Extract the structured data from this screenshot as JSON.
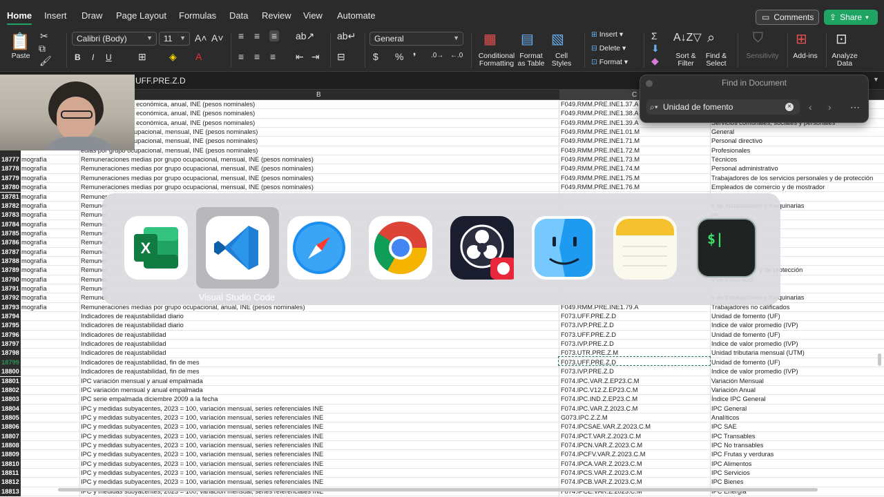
{
  "tabs": [
    "Home",
    "Insert",
    "Draw",
    "Page Layout",
    "Formulas",
    "Data",
    "Review",
    "View",
    "Automate"
  ],
  "header": {
    "comments": "Comments",
    "share": "Share"
  },
  "ribbon": {
    "paste": "Paste",
    "font_name": "Calibri (Body)",
    "font_size": "11",
    "number_format": "General",
    "conditional_formatting": [
      "Conditional",
      "Formatting"
    ],
    "format_as_table": [
      "Format",
      "as Table"
    ],
    "cell_styles": [
      "Cell",
      "Styles"
    ],
    "insert": "Insert",
    "delete": "Delete",
    "format": "Format",
    "sort_filter": [
      "Sort &",
      "Filter"
    ],
    "find_select": [
      "Find &",
      "Select"
    ],
    "sensitivity": "Sensitivity",
    "addins": "Add-ins",
    "analyze_data": [
      "Analyze",
      "Data"
    ]
  },
  "formula_bar": {
    "content": "UFF.PRE.Z.D"
  },
  "columns": {
    "b": "B",
    "c": "C"
  },
  "find_panel": {
    "title": "Find in Document",
    "query": "Unidad de fomento"
  },
  "switcher": {
    "selected_label": "Visual Studio Code",
    "apps": [
      "excel-icon",
      "vscode-icon",
      "safari-icon",
      "chrome-icon",
      "obs-icon",
      "finder-icon",
      "notes-icon",
      "terminal-icon"
    ],
    "terminal_glyph": "$|"
  },
  "colors": {
    "excel_green": "#1fa463",
    "selection_dash": "#1e7a45"
  },
  "rows": [
    {
      "n": "",
      "a": "",
      "b": "edias por actividad económica, anual, INE (pesos nominales)",
      "c": "F049.RMM.PRE.INE1.37.A",
      "d": ""
    },
    {
      "n": "",
      "a": "",
      "b": "edias por actividad económica, anual, INE (pesos nominales)",
      "c": "F049.RMM.PRE.INE1.38.A",
      "d": "Servicios comunales, sociales y personales pres"
    },
    {
      "n": "",
      "a": "",
      "b": "edias por actividad económica, anual, INE (pesos nominales)",
      "c": "F049.RMM.PRE.INE1.39.A",
      "d": "Servicios comunales, sociales y personales"
    },
    {
      "n": "",
      "a": "",
      "b": "edias por grupo ocupacional, mensual, INE (pesos nominales)",
      "c": "F049.RMM.PRE.INE1.01.M",
      "d": "General"
    },
    {
      "n": "",
      "a": "",
      "b": "edias por grupo ocupacional, mensual, INE (pesos nominales)",
      "c": "F049.RMM.PRE.INE1.71.M",
      "d": "Personal directivo"
    },
    {
      "n": "",
      "a": "",
      "b": "edias por grupo ocupacional, mensual, INE (pesos nominales)",
      "c": "F049.RMM.PRE.INE1.72.M",
      "d": "Profesionales"
    },
    {
      "n": "18777",
      "a": "mografía",
      "b": "Remuneraciones medias por grupo ocupacional, mensual, INE (pesos nominales)",
      "c": "F049.RMM.PRE.INE1.73.M",
      "d": "Técnicos"
    },
    {
      "n": "18778",
      "a": "mografía",
      "b": "Remuneraciones medias por grupo ocupacional, mensual, INE (pesos nominales)",
      "c": "F049.RMM.PRE.INE1.74.M",
      "d": "Personal administrativo"
    },
    {
      "n": "18779",
      "a": "mografía",
      "b": "Remuneraciones medias por grupo ocupacional, mensual, INE (pesos nominales)",
      "c": "F049.RMM.PRE.INE1.75.M",
      "d": "Trabajadores de los servicios personales y de protección"
    },
    {
      "n": "18780",
      "a": "mografía",
      "b": "Remuneraciones medias por grupo ocupacional, mensual, INE (pesos nominales)",
      "c": "F049.RMM.PRE.INE1.76.M",
      "d": "Empleados de comercio y de mostrador"
    },
    {
      "n": "18781",
      "a": "mografía",
      "b": "Remuner",
      "c": "",
      "d": ""
    },
    {
      "n": "18782",
      "a": "mografía",
      "b": "Remuner",
      "c": "",
      "d": "s de instalaciones y maquinarias"
    },
    {
      "n": "18783",
      "a": "mografía",
      "b": "Remuner",
      "c": "",
      "d": "os"
    },
    {
      "n": "18784",
      "a": "mografía",
      "b": "Remuner",
      "c": "",
      "d": ""
    },
    {
      "n": "18785",
      "a": "mografía",
      "b": "Remuner",
      "c": "",
      "d": ""
    },
    {
      "n": "18786",
      "a": "mografía",
      "b": "Remuner",
      "c": "",
      "d": ""
    },
    {
      "n": "18787",
      "a": "mografía",
      "b": "Remuner",
      "c": "",
      "d": ""
    },
    {
      "n": "18788",
      "a": "mografía",
      "b": "Remuner",
      "c": "",
      "d": ""
    },
    {
      "n": "18789",
      "a": "mografía",
      "b": "Remuner",
      "c": "",
      "d": "icios personales y de protección"
    },
    {
      "n": "18790",
      "a": "mografía",
      "b": "Remuner",
      "c": "",
      "d": "y de mostrador"
    },
    {
      "n": "18791",
      "a": "mografía",
      "b": "Remuner",
      "c": "",
      "d": ""
    },
    {
      "n": "18792",
      "a": "mografía",
      "b": "Remuner",
      "c": "",
      "d": "s de instalaciones y maquinarias"
    },
    {
      "n": "18793",
      "a": "mografía",
      "b": "Remuneraciones medias por grupo ocupacional, anual, INE (pesos nominales)",
      "c": "F049.RMM.PRE.INE1.79.A",
      "d": "Trabajadores no calificados"
    },
    {
      "n": "18794",
      "a": "",
      "b": "Indicadores de reajustabilidad diario",
      "c": "F073.UFF.PRE.Z.D",
      "d": "Unidad de fomento (UF)"
    },
    {
      "n": "18795",
      "a": "",
      "b": "Indicadores de reajustabilidad diario",
      "c": "F073.IVP.PRE.Z.D",
      "d": "Indice de valor promedio (IVP)"
    },
    {
      "n": "18796",
      "a": "",
      "b": "Indicadores de reajustabilidad",
      "c": "F073.UFF.PRE.Z.D",
      "d": "Unidad de fomento (UF)"
    },
    {
      "n": "18797",
      "a": "",
      "b": "Indicadores de reajustabilidad",
      "c": "F073.IVP.PRE.Z.D",
      "d": "Indice de valor promedio (IVP)"
    },
    {
      "n": "18798",
      "a": "",
      "b": "Indicadores de reajustabilidad",
      "c": "F073.UTR.PRE.Z.M",
      "d": "Unidad tributaria mensual (UTM)"
    },
    {
      "n": "18799",
      "a": "",
      "b": "Indicadores de reajustabilidad, fin de mes",
      "c": "F073.UFF.PRE.Z.D",
      "d": "Unidad de fomento (UF)"
    },
    {
      "n": "18800",
      "a": "",
      "b": "Indicadores de reajustabilidad, fin de mes",
      "c": "F073.IVP.PRE.Z.D",
      "d": "Indice de valor promedio (IVP)"
    },
    {
      "n": "18801",
      "a": "",
      "b": "IPC variación mensual y anual empalmada",
      "c": "F074.IPC.VAR.Z.EP23.C.M",
      "d": "Variación Mensual"
    },
    {
      "n": "18802",
      "a": "",
      "b": "IPC variación mensual y anual empalmada",
      "c": "F074.IPC.V12.Z.EP23.C.M",
      "d": "Variación Anual"
    },
    {
      "n": "18803",
      "a": "",
      "b": "IPC serie empalmada diciembre 2009 a la fecha",
      "c": "F074.IPC.IND.Z.EP23.C.M",
      "d": "Índice IPC General"
    },
    {
      "n": "18804",
      "a": "",
      "b": "IPC y medidas subyacentes, 2023 = 100, variación mensual, series referenciales INE",
      "c": "F074.IPC.VAR.Z.2023.C.M",
      "d": "IPC General"
    },
    {
      "n": "18805",
      "a": "",
      "b": "IPC y medidas subyacentes, 2023 = 100, variación mensual, series referenciales INE",
      "c": "G073.IPC.Z.Z.M",
      "d": "Analíticos"
    },
    {
      "n": "18806",
      "a": "",
      "b": "IPC y medidas subyacentes, 2023 = 100, variación mensual, series referenciales INE",
      "c": "F074.IPCSAE.VAR.Z.2023.C.M",
      "d": "IPC SAE"
    },
    {
      "n": "18807",
      "a": "",
      "b": "IPC y medidas subyacentes, 2023 = 100, variación mensual, series referenciales INE",
      "c": "F074.IPCT.VAR.Z.2023.C.M",
      "d": "IPC Transables"
    },
    {
      "n": "18808",
      "a": "",
      "b": "IPC y medidas subyacentes, 2023 = 100, variación mensual, series referenciales INE",
      "c": "F074.IPCN.VAR.Z.2023.C.M",
      "d": "IPC No transables"
    },
    {
      "n": "18809",
      "a": "",
      "b": "IPC y medidas subyacentes, 2023 = 100, variación mensual, series referenciales INE",
      "c": "F074.IPCFV.VAR.Z.2023.C.M",
      "d": "IPC Frutas y verduras"
    },
    {
      "n": "18810",
      "a": "",
      "b": "IPC y medidas subyacentes, 2023 = 100, variación mensual, series referenciales INE",
      "c": "F074.IPCA.VAR.Z.2023.C.M",
      "d": "IPC Alimentos"
    },
    {
      "n": "18811",
      "a": "",
      "b": "IPC y medidas subyacentes, 2023 = 100, variación mensual, series referenciales INE",
      "c": "F074.IPCS.VAR.Z.2023.C.M",
      "d": "IPC Servicios"
    },
    {
      "n": "18812",
      "a": "",
      "b": "IPC y medidas subyacentes, 2023 = 100, variación mensual, series referenciales INE",
      "c": "F074.IPCB.VAR.Z.2023.C.M",
      "d": "IPC Bienes"
    },
    {
      "n": "18813",
      "a": "",
      "b": "IPC y medidas subyacentes, 2023 = 100, variación mensual, series referenciales INE",
      "c": "F074.IPCE.VAR.Z.2023.C.M",
      "d": "IPC Energía"
    }
  ]
}
